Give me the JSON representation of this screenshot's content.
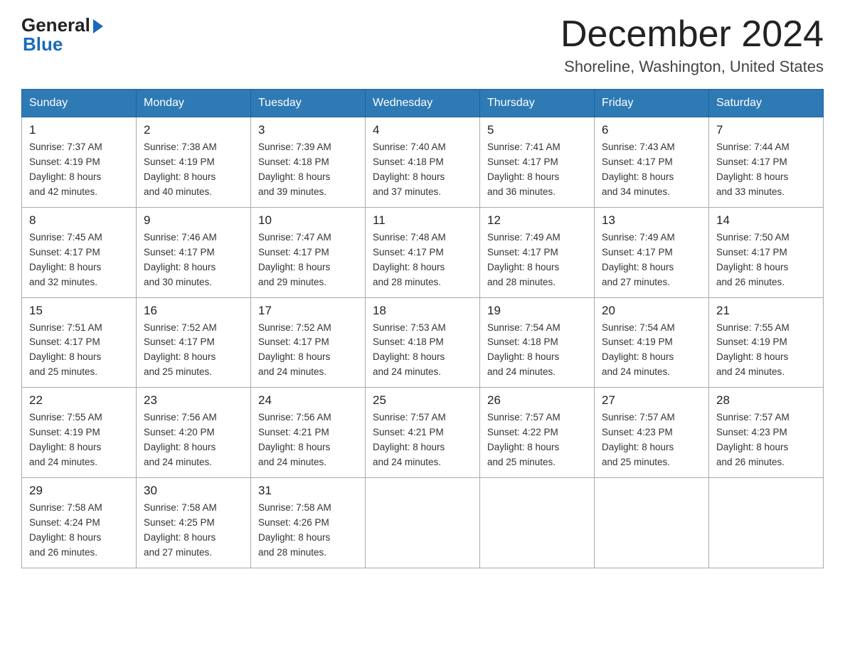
{
  "logo": {
    "general": "General",
    "blue": "Blue"
  },
  "header": {
    "month_year": "December 2024",
    "location": "Shoreline, Washington, United States"
  },
  "weekdays": [
    "Sunday",
    "Monday",
    "Tuesday",
    "Wednesday",
    "Thursday",
    "Friday",
    "Saturday"
  ],
  "weeks": [
    [
      {
        "day": "1",
        "sunrise": "7:37 AM",
        "sunset": "4:19 PM",
        "daylight": "8 hours and 42 minutes."
      },
      {
        "day": "2",
        "sunrise": "7:38 AM",
        "sunset": "4:19 PM",
        "daylight": "8 hours and 40 minutes."
      },
      {
        "day": "3",
        "sunrise": "7:39 AM",
        "sunset": "4:18 PM",
        "daylight": "8 hours and 39 minutes."
      },
      {
        "day": "4",
        "sunrise": "7:40 AM",
        "sunset": "4:18 PM",
        "daylight": "8 hours and 37 minutes."
      },
      {
        "day": "5",
        "sunrise": "7:41 AM",
        "sunset": "4:17 PM",
        "daylight": "8 hours and 36 minutes."
      },
      {
        "day": "6",
        "sunrise": "7:43 AM",
        "sunset": "4:17 PM",
        "daylight": "8 hours and 34 minutes."
      },
      {
        "day": "7",
        "sunrise": "7:44 AM",
        "sunset": "4:17 PM",
        "daylight": "8 hours and 33 minutes."
      }
    ],
    [
      {
        "day": "8",
        "sunrise": "7:45 AM",
        "sunset": "4:17 PM",
        "daylight": "8 hours and 32 minutes."
      },
      {
        "day": "9",
        "sunrise": "7:46 AM",
        "sunset": "4:17 PM",
        "daylight": "8 hours and 30 minutes."
      },
      {
        "day": "10",
        "sunrise": "7:47 AM",
        "sunset": "4:17 PM",
        "daylight": "8 hours and 29 minutes."
      },
      {
        "day": "11",
        "sunrise": "7:48 AM",
        "sunset": "4:17 PM",
        "daylight": "8 hours and 28 minutes."
      },
      {
        "day": "12",
        "sunrise": "7:49 AM",
        "sunset": "4:17 PM",
        "daylight": "8 hours and 28 minutes."
      },
      {
        "day": "13",
        "sunrise": "7:49 AM",
        "sunset": "4:17 PM",
        "daylight": "8 hours and 27 minutes."
      },
      {
        "day": "14",
        "sunrise": "7:50 AM",
        "sunset": "4:17 PM",
        "daylight": "8 hours and 26 minutes."
      }
    ],
    [
      {
        "day": "15",
        "sunrise": "7:51 AM",
        "sunset": "4:17 PM",
        "daylight": "8 hours and 25 minutes."
      },
      {
        "day": "16",
        "sunrise": "7:52 AM",
        "sunset": "4:17 PM",
        "daylight": "8 hours and 25 minutes."
      },
      {
        "day": "17",
        "sunrise": "7:52 AM",
        "sunset": "4:17 PM",
        "daylight": "8 hours and 24 minutes."
      },
      {
        "day": "18",
        "sunrise": "7:53 AM",
        "sunset": "4:18 PM",
        "daylight": "8 hours and 24 minutes."
      },
      {
        "day": "19",
        "sunrise": "7:54 AM",
        "sunset": "4:18 PM",
        "daylight": "8 hours and 24 minutes."
      },
      {
        "day": "20",
        "sunrise": "7:54 AM",
        "sunset": "4:19 PM",
        "daylight": "8 hours and 24 minutes."
      },
      {
        "day": "21",
        "sunrise": "7:55 AM",
        "sunset": "4:19 PM",
        "daylight": "8 hours and 24 minutes."
      }
    ],
    [
      {
        "day": "22",
        "sunrise": "7:55 AM",
        "sunset": "4:19 PM",
        "daylight": "8 hours and 24 minutes."
      },
      {
        "day": "23",
        "sunrise": "7:56 AM",
        "sunset": "4:20 PM",
        "daylight": "8 hours and 24 minutes."
      },
      {
        "day": "24",
        "sunrise": "7:56 AM",
        "sunset": "4:21 PM",
        "daylight": "8 hours and 24 minutes."
      },
      {
        "day": "25",
        "sunrise": "7:57 AM",
        "sunset": "4:21 PM",
        "daylight": "8 hours and 24 minutes."
      },
      {
        "day": "26",
        "sunrise": "7:57 AM",
        "sunset": "4:22 PM",
        "daylight": "8 hours and 25 minutes."
      },
      {
        "day": "27",
        "sunrise": "7:57 AM",
        "sunset": "4:23 PM",
        "daylight": "8 hours and 25 minutes."
      },
      {
        "day": "28",
        "sunrise": "7:57 AM",
        "sunset": "4:23 PM",
        "daylight": "8 hours and 26 minutes."
      }
    ],
    [
      {
        "day": "29",
        "sunrise": "7:58 AM",
        "sunset": "4:24 PM",
        "daylight": "8 hours and 26 minutes."
      },
      {
        "day": "30",
        "sunrise": "7:58 AM",
        "sunset": "4:25 PM",
        "daylight": "8 hours and 27 minutes."
      },
      {
        "day": "31",
        "sunrise": "7:58 AM",
        "sunset": "4:26 PM",
        "daylight": "8 hours and 28 minutes."
      },
      null,
      null,
      null,
      null
    ]
  ],
  "labels": {
    "sunrise": "Sunrise:",
    "sunset": "Sunset:",
    "daylight": "Daylight:"
  }
}
